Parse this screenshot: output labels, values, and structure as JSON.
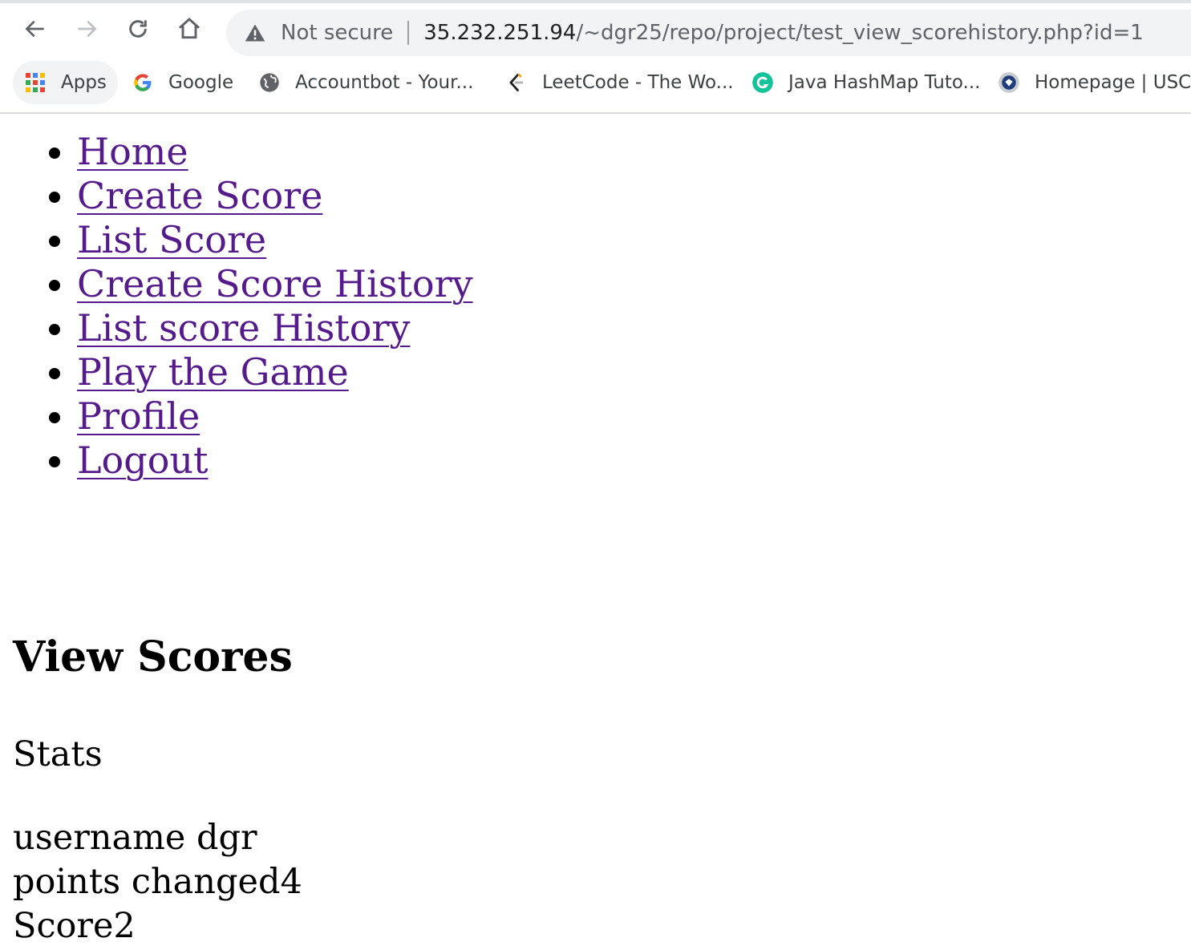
{
  "browser": {
    "security_label": "Not secure",
    "url_host": "35.232.251.94",
    "url_path": "/~dgr25/repo/project/test_view_scorehistory.php?id=1",
    "bookmarks": [
      {
        "label": "Apps",
        "icon": "apps-grid-icon"
      },
      {
        "label": "Google",
        "icon": "google-icon"
      },
      {
        "label": "Accountbot - Your...",
        "icon": "globe-icon"
      },
      {
        "label": "LeetCode - The Wo...",
        "icon": "leetcode-icon"
      },
      {
        "label": "Java HashMap Tuto...",
        "icon": "grammarly-icon"
      },
      {
        "label": "Homepage | USCIS",
        "icon": "uscis-seal-icon"
      }
    ]
  },
  "nav": {
    "items": [
      {
        "label": "Home"
      },
      {
        "label": "Create Score"
      },
      {
        "label": "List Score"
      },
      {
        "label": "Create Score History"
      },
      {
        "label": "List score History"
      },
      {
        "label": "Play the Game"
      },
      {
        "label": "Profile"
      },
      {
        "label": "Logout"
      }
    ]
  },
  "page": {
    "title": "View Scores",
    "stats_label": "Stats",
    "username_line": "username dgr",
    "points_line": "points changed4",
    "score_line": "Score2"
  },
  "colors": {
    "link_visited": "#551a8b",
    "omnibox_bg": "#f1f3f4"
  }
}
